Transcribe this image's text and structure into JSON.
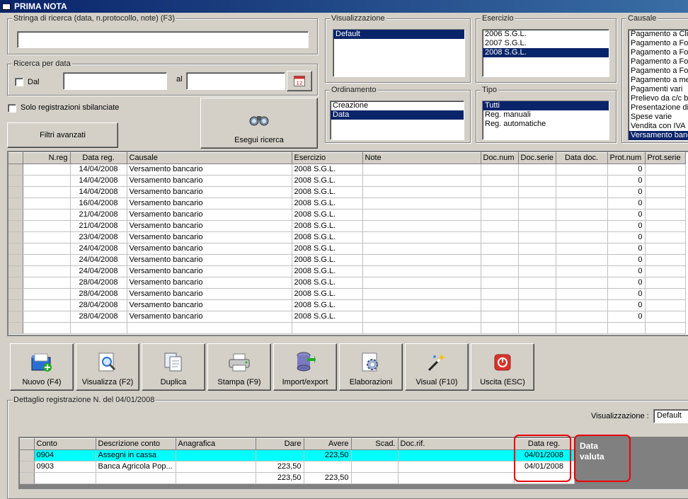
{
  "window": {
    "title": "PRIMA NOTA"
  },
  "search": {
    "label": "Stringa di ricerca (data, n.protocollo, note) (F3)",
    "value": ""
  },
  "date_search": {
    "label": "Ricerca per data",
    "dal_label": "Dal",
    "al_label": "al",
    "dal_value": "",
    "al_value": ""
  },
  "unbalanced_label": "Solo registrazioni sbilanciate",
  "filters_button": "Filtri avanzati",
  "execute_button": "Esegui ricerca",
  "visualizzazione": {
    "label": "Visualizzazione",
    "items": [
      "Default"
    ],
    "selected": 0
  },
  "esercizio": {
    "label": "Esercizio",
    "items": [
      "2006 S.G.L.",
      "2007 S.G.L.",
      "2008 S.G.L."
    ],
    "selected": 2
  },
  "causale": {
    "label": "Causale",
    "items": [
      "Pagamento a Cli",
      "Pagamento a For",
      "Pagamento a For",
      "Pagamento a For",
      "Pagamento a For",
      "Pagamento a me",
      "Pagamenti vari",
      "Prelievo da c/c b",
      "Presentazione dis",
      "Spese varie",
      "Vendita con IVA",
      "Versamento banc"
    ],
    "selected": 11
  },
  "ordinamento": {
    "label": "Ordinamento",
    "items": [
      "Creazione",
      "Data"
    ],
    "selected": 1
  },
  "tipo": {
    "label": "Tipo",
    "items": [
      "Tutti",
      "Reg. manuali",
      "Reg. automatiche"
    ],
    "selected": 0
  },
  "grid": {
    "columns": [
      "N.reg",
      "Data reg.",
      "Causale",
      "Esercizio",
      "Note",
      "Doc.num",
      "Doc.serie",
      "Data doc.",
      "Prot.num",
      "Prot.serie"
    ],
    "rows": [
      [
        "",
        "14/04/2008",
        "Versamento bancario",
        "2008 S.G.L.",
        "",
        "",
        "",
        "",
        "0",
        ""
      ],
      [
        "",
        "14/04/2008",
        "Versamento bancario",
        "2008 S.G.L.",
        "",
        "",
        "",
        "",
        "0",
        ""
      ],
      [
        "",
        "14/04/2008",
        "Versamento bancario",
        "2008 S.G.L.",
        "",
        "",
        "",
        "",
        "0",
        ""
      ],
      [
        "",
        "16/04/2008",
        "Versamento bancario",
        "2008 S.G.L.",
        "",
        "",
        "",
        "",
        "0",
        ""
      ],
      [
        "",
        "21/04/2008",
        "Versamento bancario",
        "2008 S.G.L.",
        "",
        "",
        "",
        "",
        "0",
        ""
      ],
      [
        "",
        "21/04/2008",
        "Versamento bancario",
        "2008 S.G.L.",
        "",
        "",
        "",
        "",
        "0",
        ""
      ],
      [
        "",
        "23/04/2008",
        "Versamento bancario",
        "2008 S.G.L.",
        "",
        "",
        "",
        "",
        "0",
        ""
      ],
      [
        "",
        "24/04/2008",
        "Versamento bancario",
        "2008 S.G.L.",
        "",
        "",
        "",
        "",
        "0",
        ""
      ],
      [
        "",
        "24/04/2008",
        "Versamento bancario",
        "2008 S.G.L.",
        "",
        "",
        "",
        "",
        "0",
        ""
      ],
      [
        "",
        "24/04/2008",
        "Versamento bancario",
        "2008 S.G.L.",
        "",
        "",
        "",
        "",
        "0",
        ""
      ],
      [
        "",
        "28/04/2008",
        "Versamento bancario",
        "2008 S.G.L.",
        "",
        "",
        "",
        "",
        "0",
        ""
      ],
      [
        "",
        "28/04/2008",
        "Versamento bancario",
        "2008 S.G.L.",
        "",
        "",
        "",
        "",
        "0",
        ""
      ],
      [
        "",
        "28/04/2008",
        "Versamento bancario",
        "2008 S.G.L.",
        "",
        "",
        "",
        "",
        "0",
        ""
      ],
      [
        "",
        "28/04/2008",
        "Versamento bancario",
        "2008 S.G.L.",
        "",
        "",
        "",
        "",
        "0",
        ""
      ],
      [
        "",
        "",
        "",
        "",
        "",
        "",
        "",
        "",
        "",
        ""
      ]
    ]
  },
  "toolbar": [
    {
      "label": "Nuovo (F4)",
      "icon": "folder-add-icon"
    },
    {
      "label": "Visualizza (F2)",
      "icon": "magnifier-document-icon"
    },
    {
      "label": "Duplica",
      "icon": "duplicate-icon"
    },
    {
      "label": "Stampa (F9)",
      "icon": "printer-icon"
    },
    {
      "label": "Import/export",
      "icon": "database-import-icon"
    },
    {
      "label": "Elaborazioni",
      "icon": "gear-document-icon"
    },
    {
      "label": "Visual (F10)",
      "icon": "magic-wand-icon"
    },
    {
      "label": "Uscita (ESC)",
      "icon": "exit-icon"
    }
  ],
  "detail": {
    "label": "Dettaglio registrazione N.  del 04/01/2008",
    "view_label": "Visualizzazione :",
    "view_value": "Default",
    "columns": [
      "Conto",
      "Descrizione conto",
      "Anagrafica",
      "Dare",
      "Avere",
      "Scad.",
      "Doc.rif.",
      "Data reg."
    ],
    "rows": [
      [
        "0904",
        "Assegni in cassa",
        "",
        "",
        "223,50",
        "",
        "",
        "04/01/2008"
      ],
      [
        "0903",
        "Banca Agricola Pop...",
        "",
        "223,50",
        "",
        "",
        "",
        "04/01/2008"
      ],
      [
        "",
        "",
        "",
        "223,50",
        "223,50",
        "",
        "",
        ""
      ]
    ],
    "extra_column_label": "Data valuta"
  },
  "colors": {
    "selection": "#0a246a",
    "highlight_row": "#00ffff",
    "annotation": "#e00000"
  }
}
